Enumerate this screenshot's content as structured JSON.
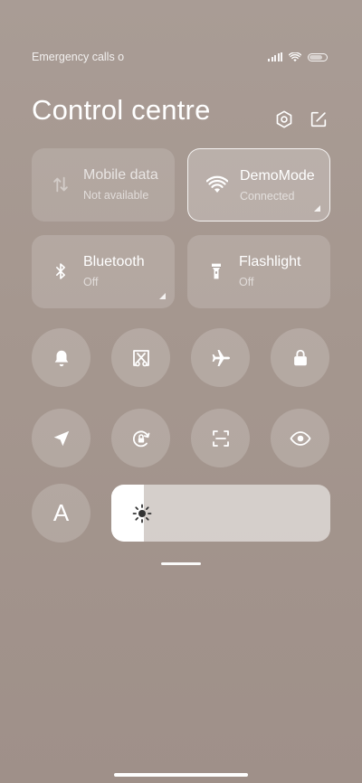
{
  "status_bar": {
    "carrier_text": "Emergency calls o"
  },
  "header": {
    "title": "Control centre",
    "settings_icon": "settings-hex-icon",
    "edit_icon": "edit-icon"
  },
  "tiles": [
    {
      "name": "Mobile data",
      "status": "Not available",
      "icon": "mobile-data-icon",
      "state": "disabled",
      "has_expand": false
    },
    {
      "name": "DemoMode",
      "status": "Connected",
      "icon": "wifi-icon",
      "state": "active",
      "has_expand": true
    },
    {
      "name": "Bluetooth",
      "status": "Off",
      "icon": "bluetooth-icon",
      "state": "off",
      "has_expand": true
    },
    {
      "name": "Flashlight",
      "status": "Off",
      "icon": "flashlight-icon",
      "state": "off",
      "has_expand": false
    }
  ],
  "toggles_row1": [
    "bell-icon",
    "screenshot-scissors-icon",
    "airplane-icon",
    "lock-icon"
  ],
  "toggles_row2": [
    "location-icon",
    "rotation-lock-icon",
    "scan-icon",
    "eye-icon"
  ],
  "auto_brightness": {
    "label": "A"
  },
  "brightness": {
    "level": 0.15,
    "icon": "sun-icon"
  },
  "colors": {
    "background": "#a89b94",
    "tile": "rgba(255,255,255,0.16)",
    "slider_fill": "#ffffff"
  }
}
